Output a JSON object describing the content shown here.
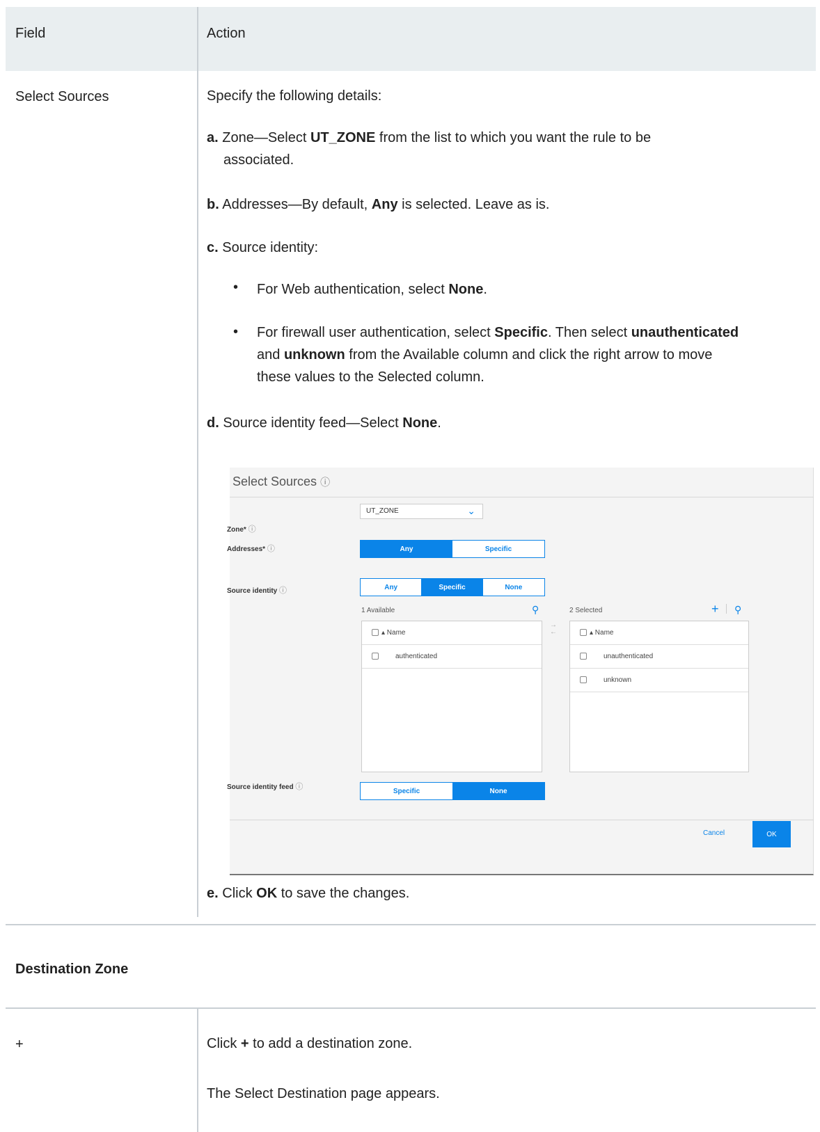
{
  "table": {
    "header": {
      "field": "Field",
      "action": "Action"
    },
    "row1": {
      "field": "Select Sources",
      "intro": "Specify the following details:",
      "step_a": {
        "letter": "a.",
        "pre": "Zone—Select ",
        "bold": "UT_ZONE",
        "post": " from the list to which you want the rule to be",
        "line2": "associated."
      },
      "step_b": {
        "letter": "b.",
        "pre": "Addresses—By default, ",
        "bold": "Any",
        "post": " is selected. Leave as is."
      },
      "step_c": {
        "letter": "c.",
        "text": "Source identity:"
      },
      "bullet1": {
        "pre": "For Web authentication, select ",
        "bold": "None",
        "post": "."
      },
      "bullet2": {
        "pre": "For firewall user authentication, select ",
        "bold1": "Specific",
        "mid": ". Then select ",
        "bold2": "unauthenticated",
        "bold3": "and ",
        "line2_bold": "unknown",
        "line2_post": " from the Available column and click the right arrow to move",
        "line3": "these values to the Selected column."
      },
      "step_d": {
        "letter": "d.",
        "pre": "Source identity feed—Select ",
        "bold": "None",
        "post": "."
      },
      "step_e": {
        "letter": "e.",
        "pre": "Click ",
        "bold": "OK",
        "post": " to save the changes."
      }
    },
    "section": "Destination Zone",
    "row2": {
      "field": "+",
      "line1_pre": "Click ",
      "line1_bold": "+",
      "line1_post": " to add a destination zone.",
      "line2": "The Select Destination page appears."
    }
  },
  "screenshot": {
    "title": "Select Sources",
    "help_glyph": "ⓘ",
    "zone_label": "Zone*",
    "zone_value": "UT_ZONE",
    "addresses_label": "Addresses*",
    "addresses_options": [
      "Any",
      "Specific"
    ],
    "addresses_selected": "Any",
    "source_identity_label": "Source identity",
    "source_identity_options": [
      "Any",
      "Specific",
      "None"
    ],
    "source_identity_selected": "Specific",
    "available_count": "1 Available",
    "selected_count": "2 Selected",
    "name_header": "▴ Name",
    "available_items": [
      "authenticated"
    ],
    "selected_items": [
      "unauthenticated",
      "unknown"
    ],
    "feed_label": "Source identity feed",
    "feed_options": [
      "Specific",
      "None"
    ],
    "feed_selected": "None",
    "cancel_label": "Cancel",
    "ok_label": "OK",
    "accent_color": "#0a84e8"
  }
}
